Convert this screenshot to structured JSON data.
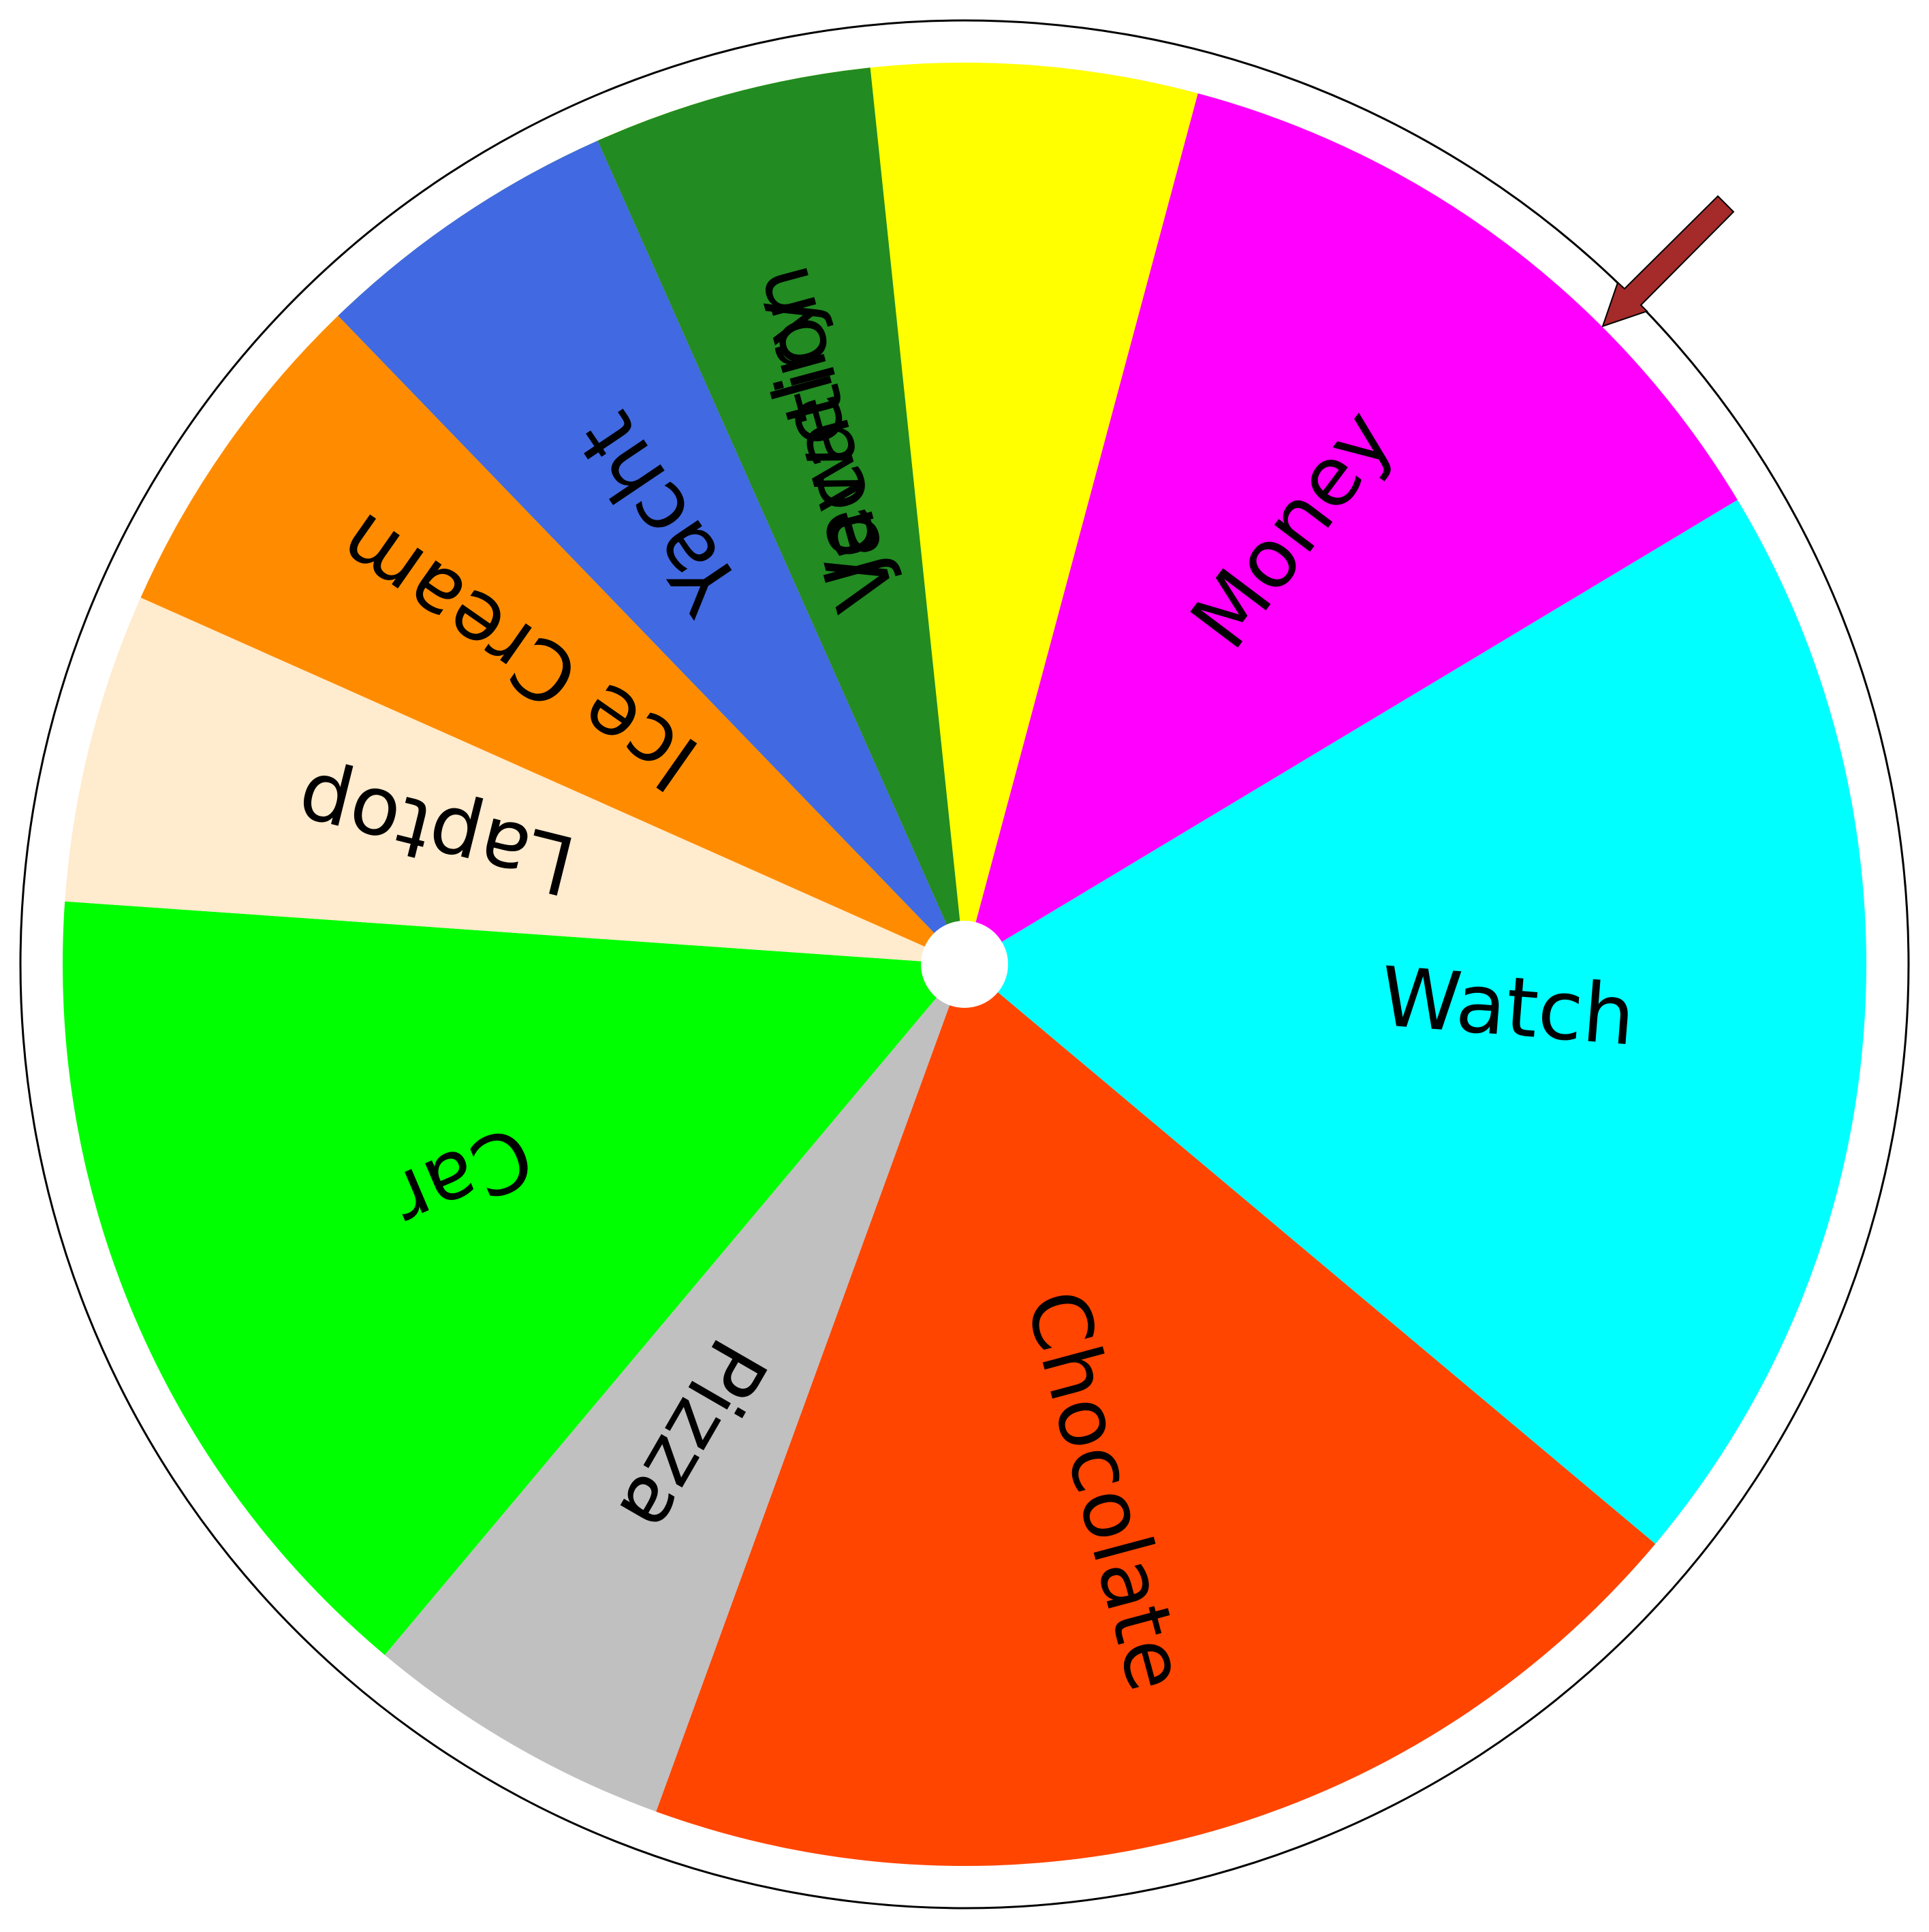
{
  "wheel": {
    "segments": [
      {
        "label": "Jewelry",
        "color": "#FFFF00",
        "start_deg": 314,
        "end_deg": 375
      },
      {
        "label": "Money",
        "color": "#FF00FF",
        "start_deg": 15,
        "end_deg": 59
      },
      {
        "label": "Watch",
        "color": "#00FFFF",
        "start_deg": 59,
        "end_deg": 130
      },
      {
        "label": "Chocolate",
        "color": "#FF4500",
        "start_deg": 130,
        "end_deg": 200
      },
      {
        "label": "Pizza",
        "color": "#C0C0C0",
        "start_deg": 200,
        "end_deg": 220
      },
      {
        "label": "Car",
        "color": "#00FF00",
        "start_deg": 220,
        "end_deg": 274
      },
      {
        "label": "Laptop",
        "color": "#FFEBCD",
        "start_deg": 274,
        "end_deg": 294
      },
      {
        "label": "Ice Cream",
        "color": "#FF8C00",
        "start_deg": 294,
        "end_deg": 316
      },
      {
        "label": "Yacht",
        "color": "#4169E1",
        "start_deg": 316,
        "end_deg": 336
      },
      {
        "label": "Vacation",
        "color": "#228B22",
        "start_deg": 336,
        "end_deg": 354
      }
    ],
    "pointer_color": "#A52A2A",
    "hub_color": "#FFFFFF",
    "rim_color": "#000000"
  }
}
